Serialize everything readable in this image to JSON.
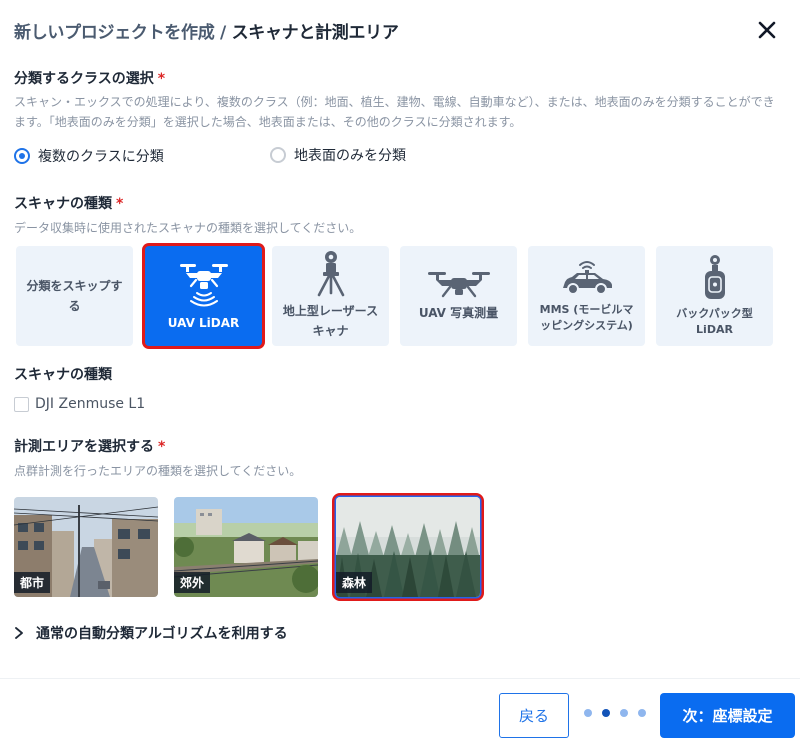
{
  "header": {
    "title_prefix": "新しいプロジェクトを作成 /",
    "title_step": "スキャナと計測エリア"
  },
  "classes": {
    "heading": "分類するクラスの選択",
    "required_mark": "*",
    "description": "スキャン・エックスでの処理により、複数のクラス（例：地面、植生、建物、電線、自動車など）、または、地表面のみを分類することができます。「地表面のみを分類」を選択した場合、地表面または、その他のクラスに分類されます。",
    "options": [
      {
        "label": "複数のクラスに分類",
        "checked": true
      },
      {
        "label": "地表面のみを分類",
        "checked": false
      }
    ]
  },
  "scanner_type": {
    "heading": "スキャナの種類",
    "required_mark": "*",
    "description": "データ収集時に使用されたスキャナの種類を選択してください。",
    "tiles": [
      {
        "label": "分類をスキップする",
        "icon": "skip",
        "selected": false
      },
      {
        "label": "UAV LiDAR",
        "icon": "drone-lidar-icon",
        "selected": true
      },
      {
        "label": "地上型レーザースキャナ",
        "icon": "tripod-scanner-icon",
        "selected": false
      },
      {
        "label": "UAV 写真測量",
        "icon": "drone-icon",
        "selected": false
      },
      {
        "label": "MMS (モービルマッピングシステム)",
        "icon": "car-scanner-icon",
        "selected": false
      },
      {
        "label": "バックパック型LiDAR",
        "icon": "backpack-scanner-icon",
        "selected": false
      }
    ]
  },
  "scanner_model": {
    "heading": "スキャナの種類",
    "checkbox_label": "DJI Zenmuse L1",
    "checked": false
  },
  "area": {
    "heading": "計測エリアを選択する",
    "required_mark": "*",
    "description": "点群計測を行ったエリアの種類を選択してください。",
    "options": [
      {
        "label": "都市",
        "selected": false
      },
      {
        "label": "郊外",
        "selected": false
      },
      {
        "label": "森林",
        "selected": true
      }
    ]
  },
  "advanced": {
    "label": "通常の自動分類アルゴリズムを利用する"
  },
  "footer": {
    "back_label": "戻る",
    "next_label": "次：座標設定",
    "steps_total": 4,
    "steps_current": 2
  },
  "colors": {
    "primary": "#0a6cf0",
    "required": "#dc2626",
    "selection_outline": "#e01a1a"
  }
}
